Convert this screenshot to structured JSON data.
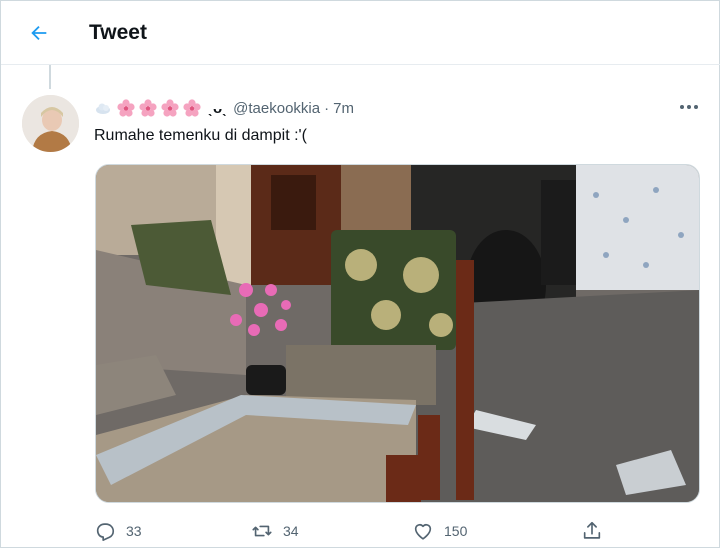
{
  "header": {
    "title": "Tweet"
  },
  "tweet": {
    "name_suffix": "ˎᴗˎ",
    "handle": "@taekookkia",
    "separator": "·",
    "time": "7m",
    "text": "Rumahe temenku di dampit :'(",
    "stats": {
      "replies": "33",
      "retweets": "34",
      "likes": "150"
    }
  },
  "icons": {
    "back": "back-arrow-icon",
    "more": "more-horizontal-icon",
    "reply": "reply-icon",
    "retweet": "retweet-icon",
    "like": "heart-icon",
    "share": "share-icon"
  },
  "colors": {
    "accent": "#1d9bf0",
    "secondary_text": "#536471",
    "border": "#cfd9de"
  }
}
